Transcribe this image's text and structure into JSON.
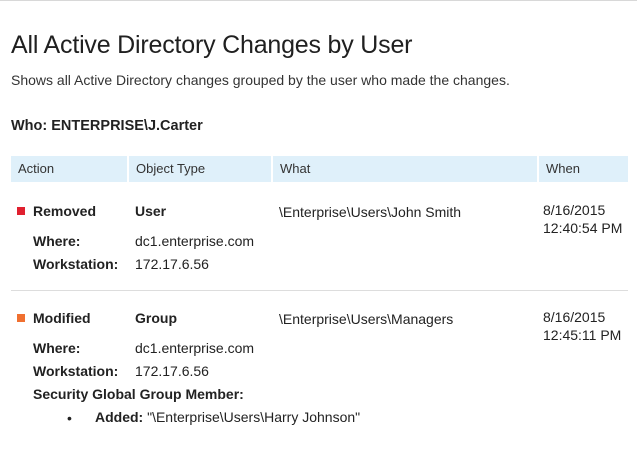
{
  "report": {
    "title": "All Active Directory Changes by User",
    "subtitle": "Shows all Active Directory changes grouped by the user who made the changes.",
    "who_label": "Who:",
    "who_value": "ENTERPRISE\\J.Carter"
  },
  "table": {
    "columns": [
      "Action",
      "Object Type",
      "What",
      "When"
    ]
  },
  "labels": {
    "where": "Where:",
    "workstation": "Workstation:",
    "added": "Added:"
  },
  "entries": [
    {
      "action": "Removed",
      "action_color": "#e0202f",
      "object_type": "User",
      "what": "\\Enterprise\\Users\\John Smith",
      "when_date": "8/16/2015",
      "when_time": "12:40:54 PM",
      "where": "dc1.enterprise.com",
      "workstation": "172.17.6.56"
    },
    {
      "action": "Modified",
      "action_color": "#f07030",
      "object_type": "Group",
      "what": "\\Enterprise\\Users\\Managers",
      "when_date": "8/16/2015",
      "when_time": "12:45:11 PM",
      "where": "dc1.enterprise.com",
      "workstation": "172.17.6.56",
      "section": "Security Global Group Member:",
      "bullet": "•",
      "added_value": "\"\\Enterprise\\Users\\Harry Johnson\""
    }
  ]
}
